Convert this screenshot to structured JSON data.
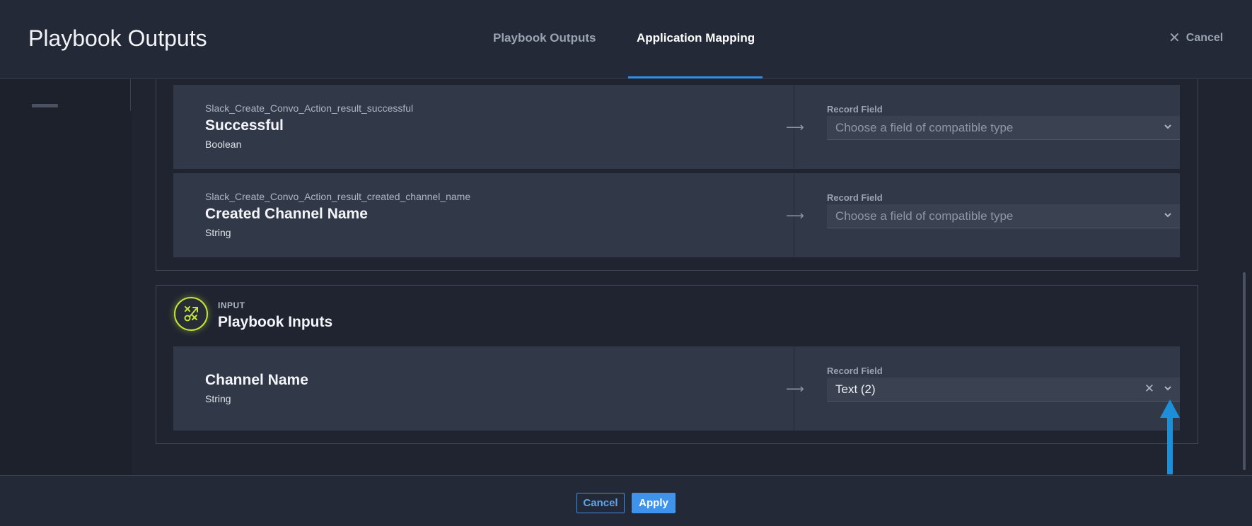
{
  "header": {
    "title": "Playbook Outputs",
    "tabs": [
      {
        "label": "Playbook Outputs",
        "active": false
      },
      {
        "label": "Application Mapping",
        "active": true
      }
    ],
    "cancel_label": "Cancel"
  },
  "outputs": [
    {
      "sub": "Slack_Create_Convo_Action_result_successful",
      "name": "Successful",
      "type": "Boolean",
      "arrow": "⟶",
      "record_field_label": "Record Field",
      "placeholder": "Choose a field of compatible type"
    },
    {
      "sub": "Slack_Create_Convo_Action_result_created_channel_name",
      "name": "Created Channel Name",
      "type": "String",
      "arrow": "⟶",
      "record_field_label": "Record Field",
      "placeholder": "Choose a field of compatible type"
    }
  ],
  "input_section": {
    "kicker": "INPUT",
    "title": "Playbook Inputs",
    "icon_color": "#c6e23a",
    "rows": [
      {
        "name": "Channel Name",
        "type": "String",
        "arrow": "⟶",
        "record_field_label": "Record Field",
        "value": "Text (2)",
        "clear": "✕"
      }
    ]
  },
  "footer": {
    "cancel_label": "Cancel",
    "apply_label": "Apply"
  },
  "colors": {
    "accent": "#3f93ec",
    "tab_underline": "#2f8ee8",
    "annotation_arrow": "#1b8fd8"
  }
}
